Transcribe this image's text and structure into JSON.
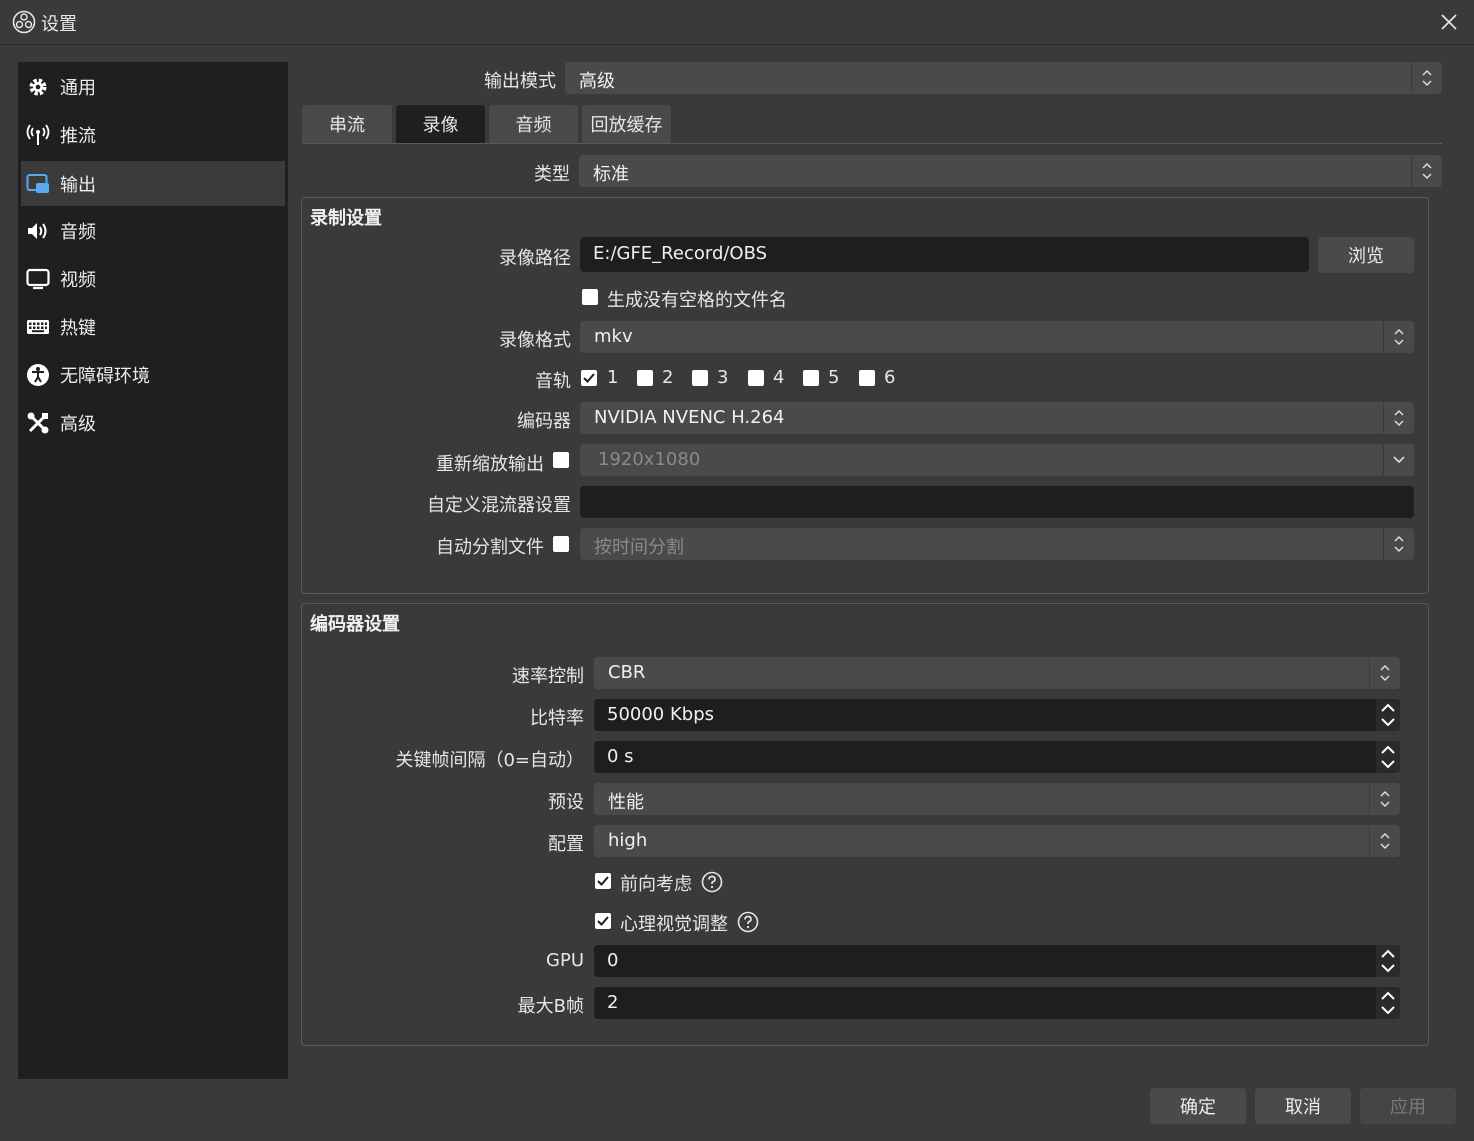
{
  "window": {
    "title": "设置"
  },
  "sidebar": {
    "items": [
      {
        "label": "通用",
        "icon": "gear-icon",
        "active": false
      },
      {
        "label": "推流",
        "icon": "antenna-icon",
        "active": false
      },
      {
        "label": "输出",
        "icon": "output-icon",
        "active": true
      },
      {
        "label": "音频",
        "icon": "speaker-icon",
        "active": false
      },
      {
        "label": "视频",
        "icon": "monitor-icon",
        "active": false
      },
      {
        "label": "热键",
        "icon": "keyboard-icon",
        "active": false
      },
      {
        "label": "无障碍环境",
        "icon": "accessibility-icon",
        "active": false
      },
      {
        "label": "高级",
        "icon": "tools-icon",
        "active": false
      }
    ]
  },
  "output_mode": {
    "label": "输出模式",
    "value": "高级"
  },
  "tabs": [
    {
      "label": "串流",
      "active": false
    },
    {
      "label": "录像",
      "active": true
    },
    {
      "label": "音频",
      "active": false
    },
    {
      "label": "回放缓存",
      "active": false
    }
  ],
  "type": {
    "label": "类型",
    "value": "标准"
  },
  "recording": {
    "title": "录制设置",
    "path": {
      "label": "录像路径",
      "value": "E:/GFE_Record/OBS",
      "browse": "浏览"
    },
    "no_space": {
      "label": "生成没有空格的文件名",
      "checked": false
    },
    "format": {
      "label": "录像格式",
      "value": "mkv"
    },
    "tracks": {
      "label": "音轨",
      "items": [
        {
          "label": "1",
          "checked": true
        },
        {
          "label": "2",
          "checked": false
        },
        {
          "label": "3",
          "checked": false
        },
        {
          "label": "4",
          "checked": false
        },
        {
          "label": "5",
          "checked": false
        },
        {
          "label": "6",
          "checked": false
        }
      ]
    },
    "encoder": {
      "label": "编码器",
      "value": "NVIDIA NVENC H.264"
    },
    "rescale": {
      "label": "重新缩放输出",
      "checked": false,
      "value": "1920x1080"
    },
    "muxer": {
      "label": "自定义混流器设置",
      "value": ""
    },
    "split": {
      "label": "自动分割文件",
      "checked": false,
      "value": "按时间分割"
    }
  },
  "encoder_settings": {
    "title": "编码器设置",
    "rate_control": {
      "label": "速率控制",
      "value": "CBR"
    },
    "bitrate": {
      "label": "比特率",
      "value": "50000 Kbps"
    },
    "keyframe": {
      "label": "关键帧间隔（0=自动）",
      "value": "0 s"
    },
    "preset": {
      "label": "预设",
      "value": "性能"
    },
    "profile": {
      "label": "配置",
      "value": "high"
    },
    "lookahead": {
      "label": "前向考虑",
      "checked": true
    },
    "psycho": {
      "label": "心理视觉调整",
      "checked": true
    },
    "gpu": {
      "label": "GPU",
      "value": "0"
    },
    "bframes": {
      "label": "最大B帧",
      "value": "2"
    }
  },
  "buttons": {
    "ok": "确定",
    "cancel": "取消",
    "apply": "应用"
  }
}
